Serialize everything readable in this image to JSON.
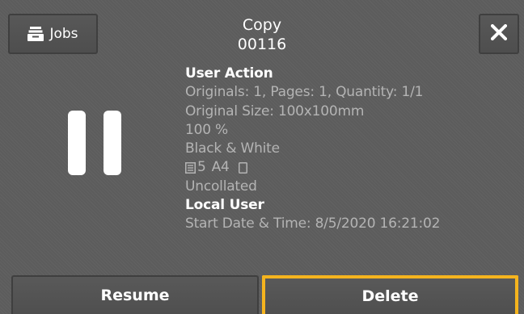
{
  "header": {
    "jobs_label": "Jobs",
    "jobs_icon": "tray-stack-icon",
    "title": "Copy",
    "job_number": "00116",
    "close_icon": "close-icon"
  },
  "status": {
    "state_icon": "pause-icon"
  },
  "details": {
    "user_action": "User Action",
    "originals_line": "Originals: 1, Pages: 1, Quantity: 1/1",
    "original_size": "Original Size: 100x100mm",
    "reduce_enlarge": "100 %",
    "color_mode": "Black & White",
    "paper_tray": "5",
    "paper_size": "A4",
    "collation": "Uncollated",
    "user": "Local User",
    "start_time": "Start Date & Time: 8/5/2020 16:21:02"
  },
  "footer": {
    "resume_label": "Resume",
    "delete_label": "Delete",
    "highlight_color": "#f5b41e"
  }
}
